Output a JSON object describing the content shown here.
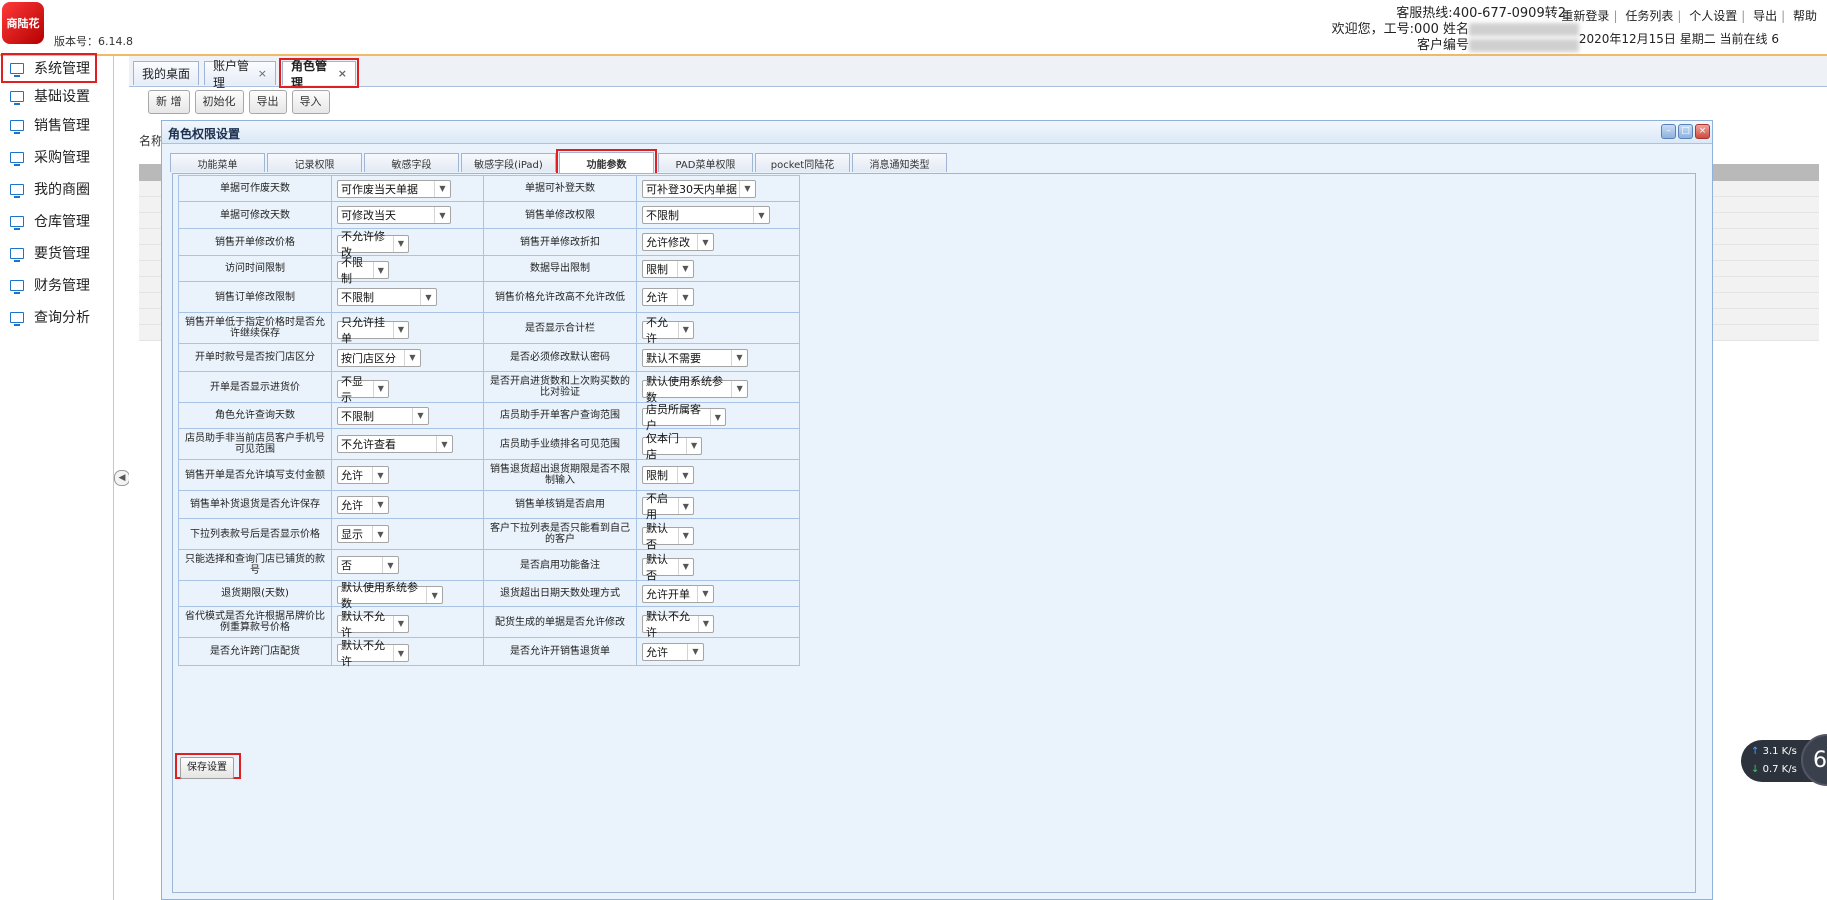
{
  "header": {
    "logo_text": "商陆花",
    "version": "版本号：6.14.8",
    "hotline": "客服热线:400-677-0909转2",
    "welcome_prefix": "欢迎您，工号:000 姓名",
    "customer_prefix": "客户编号",
    "links": [
      "重新登录",
      "任务列表",
      "个人设置",
      "导出",
      "帮助"
    ],
    "date": "2020年12月15日 星期二 当前在线 6"
  },
  "sidebar": {
    "items": [
      {
        "label": "系统管理"
      },
      {
        "label": "基础设置"
      },
      {
        "label": "销售管理"
      },
      {
        "label": "采购管理"
      },
      {
        "label": "我的商圈"
      },
      {
        "label": "仓库管理"
      },
      {
        "label": "要货管理"
      },
      {
        "label": "财务管理"
      },
      {
        "label": "查询分析"
      }
    ]
  },
  "tabs": {
    "desktop": "我的桌面",
    "account": "账户管理",
    "role": "角色管理",
    "close": "×"
  },
  "toolbar": {
    "add": "新 增",
    "init": "初始化",
    "export": "导出",
    "import": "导入"
  },
  "name_label": "名称",
  "dialog": {
    "title": "角色权限设置",
    "tabs": [
      "功能菜单",
      "记录权限",
      "敏感字段",
      "敏感字段(iPad)",
      "功能参数",
      "PAD菜单权限",
      "pocket同陆花",
      "消息通知类型"
    ],
    "save_label": "保存设置"
  },
  "settings": [
    {
      "l1": "单据可作废天数",
      "v1": "可作废当天单据",
      "l2": "单据可补登天数",
      "v2": "可补登30天内单据"
    },
    {
      "l1": "单据可修改天数",
      "v1": "可修改当天",
      "l2": "销售单修改权限",
      "v2": "不限制"
    },
    {
      "l1": "销售开单修改价格",
      "v1": "不允许修改",
      "l2": "销售开单修改折扣",
      "v2": "允许修改"
    },
    {
      "l1": "访问时间限制",
      "v1": "不限制",
      "l2": "数据导出限制",
      "v2": "限制"
    },
    {
      "l1": "销售订单修改限制",
      "v1": "不限制",
      "l2": "销售价格允许改高不允许改低",
      "v2": "允许"
    },
    {
      "l1": "销售开单低于指定价格时是否允许继续保存",
      "v1": "只允许挂单",
      "l2": "是否显示合计栏",
      "v2": "不允许"
    },
    {
      "l1": "开单时款号是否按门店区分",
      "v1": "按门店区分",
      "l2": "是否必须修改默认密码",
      "v2": "默认不需要"
    },
    {
      "l1": "开单是否显示进货价",
      "v1": "不显示",
      "l2": "是否开启进货数和上次购买数的比对验证",
      "v2": "默认使用系统参数"
    },
    {
      "l1": "角色允许查询天数",
      "v1": "不限制",
      "l2": "店员助手开单客户查询范围",
      "v2": "店员所属客户"
    },
    {
      "l1": "店员助手非当前店员客户手机号可见范围",
      "v1": "不允许查看",
      "l2": "店员助手业绩排名可见范围",
      "v2": "仅本门店"
    },
    {
      "l1": "销售开单是否允许填写支付金额",
      "v1": "允许",
      "l2": "销售退货超出退货期限是否不限制输入",
      "v2": "限制"
    },
    {
      "l1": "销售单补货退货是否允许保存",
      "v1": "允许",
      "l2": "销售单核销是否启用",
      "v2": "不启用"
    },
    {
      "l1": "下拉列表款号后是否显示价格",
      "v1": "显示",
      "l2": "客户下拉列表是否只能看到自己的客户",
      "v2": "默认否"
    },
    {
      "l1": "只能选择和查询门店已铺货的款号",
      "v1": "否",
      "l2": "是否启用功能备注",
      "v2": "默认否"
    },
    {
      "l1": "退货期限(天数)",
      "v1": "默认使用系统参数",
      "l2": "退货超出日期天数处理方式",
      "v2": "允许开单"
    },
    {
      "l1": "省代模式是否允许根据吊牌价比例重算款号价格",
      "v1": "默认不允许",
      "l2": "配货生成的单据是否允许修改",
      "v2": "默认不允许"
    },
    {
      "l1": "是否允许跨门店配货",
      "v1": "默认不允许",
      "l2": "是否允许开销售退货单",
      "v2": "允许"
    }
  ],
  "net": {
    "up": "3.1",
    "down": "0.7",
    "unit": "K/s",
    "count": "6"
  }
}
